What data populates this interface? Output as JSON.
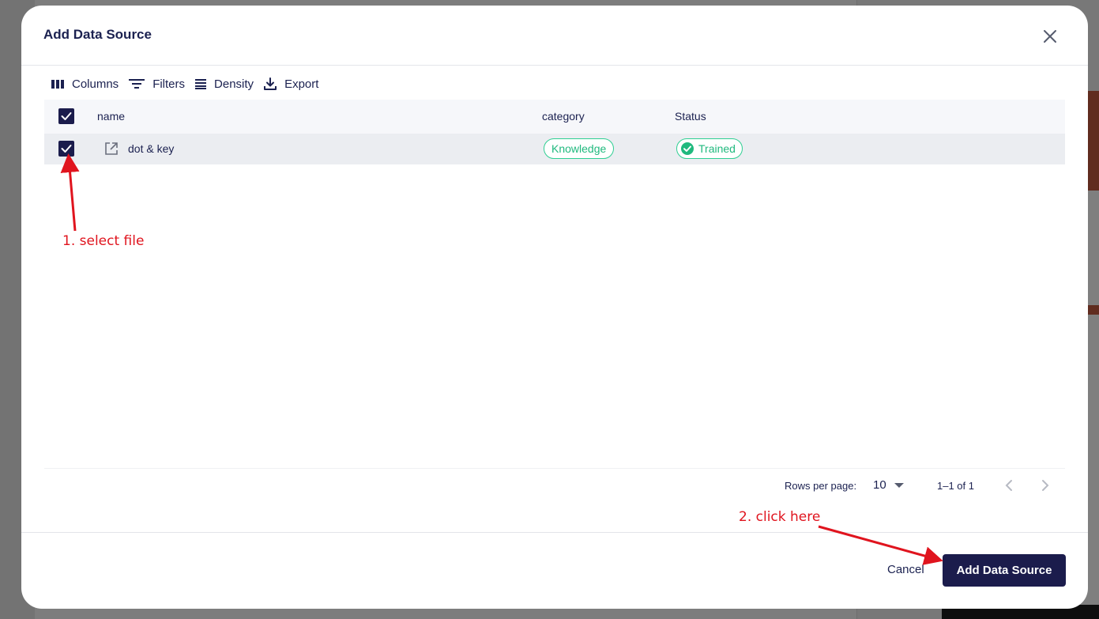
{
  "dialog": {
    "title": "Add Data Source",
    "close_icon": "close-icon"
  },
  "toolbar": {
    "columns_label": "Columns",
    "filters_label": "Filters",
    "density_label": "Density",
    "export_label": "Export"
  },
  "table": {
    "columns": [
      "name",
      "category",
      "Status"
    ],
    "rows": [
      {
        "name": "dot & key",
        "category": "Knowledge",
        "status": "Trained",
        "selected": true
      }
    ],
    "pagination": {
      "rows_per_page_label": "Rows per page:",
      "rows_per_page_value": "10",
      "range_text": "1–1 of 1"
    }
  },
  "footer": {
    "cancel_label": "Cancel",
    "submit_label": "Add Data Source"
  },
  "annotations": {
    "step1": "1. select file",
    "step2": "2. click here"
  },
  "colors": {
    "primary": "#1b1c4c",
    "chip_green": "#20b97e",
    "annotation_red": "#e0141e"
  }
}
